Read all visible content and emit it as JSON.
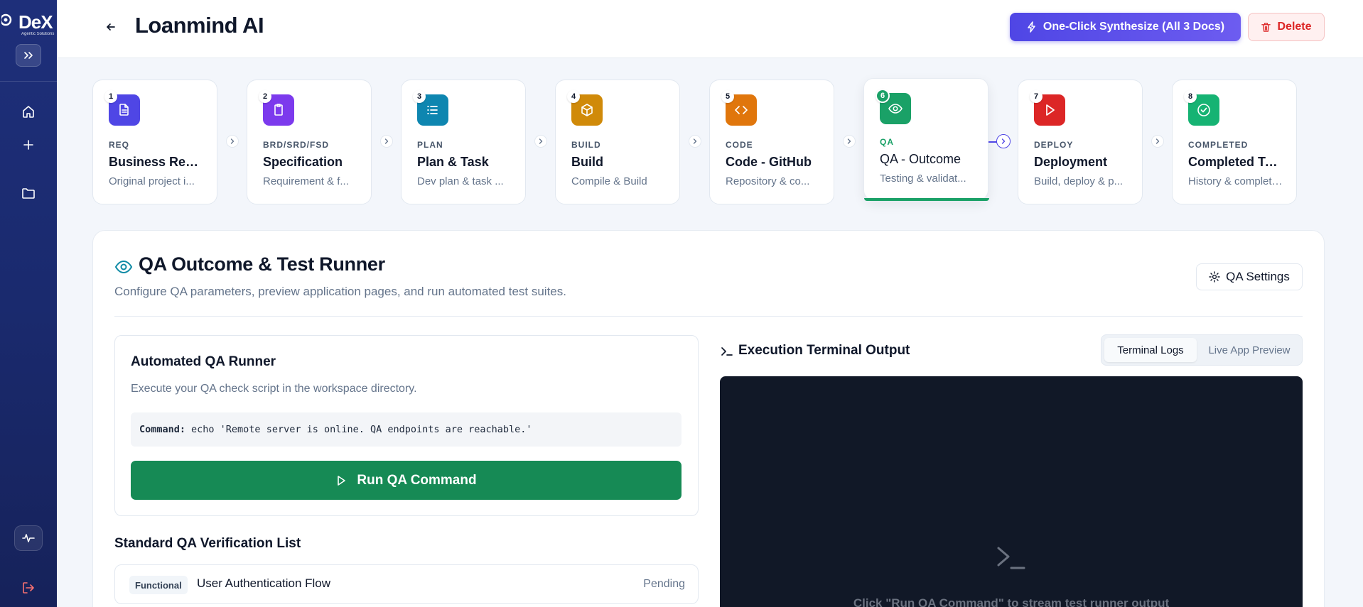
{
  "app": {
    "logo_text": "DeX",
    "logo_tagline": "Agentic Solutions"
  },
  "header": {
    "title": "Loanmind AI",
    "synthesize_label": "One-Click Synthesize (All 3 Docs)",
    "delete_label": "Delete"
  },
  "steps": [
    {
      "num": "1",
      "cat": "REQ",
      "title": "Business Req...",
      "sub": "Original project i...",
      "color": "#4f46e5",
      "icon": "document-icon"
    },
    {
      "num": "2",
      "cat": "BRD/SRD/FSD",
      "title": "Specification",
      "sub": "Requirement & f...",
      "color": "#7c3aed",
      "icon": "clipboard-icon"
    },
    {
      "num": "3",
      "cat": "PLAN",
      "title": "Plan & Task",
      "sub": "Dev plan & task ...",
      "color": "#0e86b0",
      "icon": "list-icon"
    },
    {
      "num": "4",
      "cat": "BUILD",
      "title": "Build",
      "sub": "Compile & Build",
      "color": "#d08a09",
      "icon": "box-icon"
    },
    {
      "num": "5",
      "cat": "CODE",
      "title": "Code - GitHub",
      "sub": "Repository & co...",
      "color": "#e0760c",
      "icon": "code-icon"
    },
    {
      "num": "6",
      "cat": "QA",
      "title": "QA - Outcome",
      "sub": "Testing & validat...",
      "color": "#1aa167",
      "icon": "eye-icon"
    },
    {
      "num": "7",
      "cat": "DEPLOY",
      "title": "Deployment",
      "sub": "Build, deploy & p...",
      "color": "#dc2626",
      "icon": "play-icon"
    },
    {
      "num": "8",
      "cat": "COMPLETED",
      "title": "Completed Tasks",
      "sub": "History & completed it...",
      "color": "#16b373",
      "icon": "check-circle-icon"
    }
  ],
  "section": {
    "title": "QA Outcome & Test Runner",
    "subtitle": "Configure QA parameters, preview application pages, and run automated test suites.",
    "settings_label": "QA Settings"
  },
  "runner": {
    "title": "Automated QA Runner",
    "description": "Execute your QA check script in the workspace directory.",
    "command_label": "Command:",
    "command": "echo 'Remote server is online. QA endpoints are reachable.'",
    "run_label": "Run QA Command"
  },
  "verification": {
    "title": "Standard QA Verification List",
    "items": [
      {
        "badge": "Functional",
        "label": "User Authentication Flow",
        "status": "Pending"
      }
    ]
  },
  "terminal": {
    "title": "Execution Terminal Output",
    "tabs": [
      "Terminal Logs",
      "Live App Preview"
    ],
    "hint": "Click \"Run QA Command\" to stream test runner output"
  }
}
